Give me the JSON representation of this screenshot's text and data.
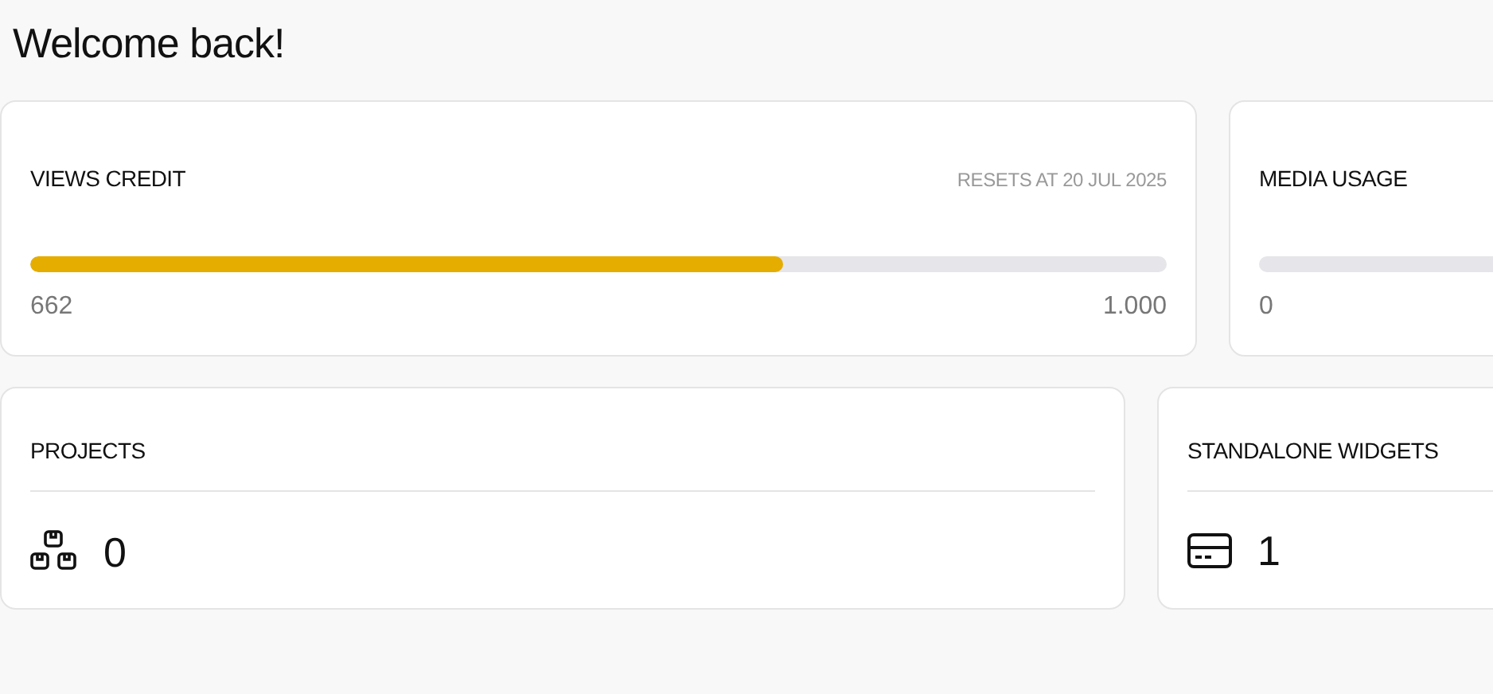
{
  "heading": "Welcome back!",
  "usage_cards": [
    {
      "title": "VIEWS CREDIT",
      "note": "RESETS AT 20 JUL 2025",
      "level": 0.662,
      "reading": "662",
      "limit": "1.000"
    },
    {
      "title": "MEDIA USAGE",
      "level": 0,
      "reading": "0"
    }
  ],
  "count_cards": [
    {
      "title": "PROJECTS",
      "kind": "boxes",
      "count": "0"
    },
    {
      "title": "STANDALONE WIDGETS",
      "kind": "card",
      "count": "1"
    }
  ]
}
